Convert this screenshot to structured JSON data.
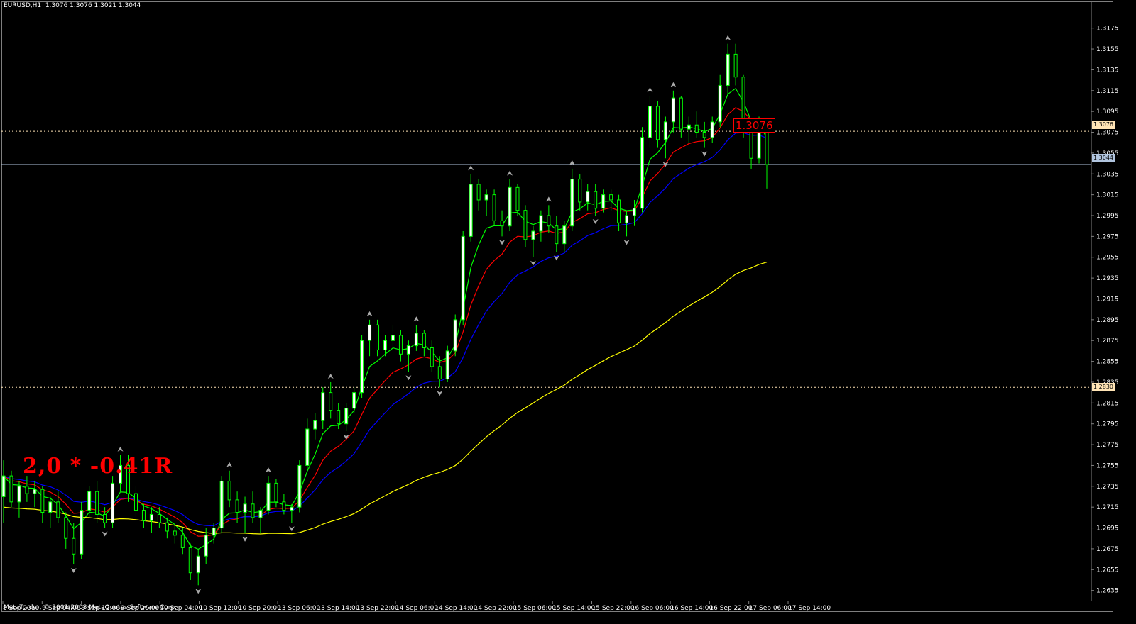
{
  "symbol_header": "EURUSD,H1  1.3076 1.3076 1.3021 1.3044",
  "copyright": "MetaTrader, © 2001-2008 MetaQuotes Software Corp.",
  "annotation_text": "2,0 * -0.41R",
  "level_label": "1.3076",
  "price_tags": {
    "upper_level": "1.3076",
    "current_price": "1.3044",
    "lower_level": "1.2830"
  },
  "colors": {
    "background": "#000000",
    "bull_candle": "#ffffff",
    "bear_candle": "#000000",
    "candle_wick": "#00ff00",
    "ma_fast": "#00ff00",
    "ma_mid": "#ff0000",
    "ma_slow": "#0000ff",
    "ma_long": "#ffff00",
    "level_lines": "#ffe4b5",
    "current_price_line": "#b0c4de",
    "annotation": "#ff0000"
  },
  "price_axis": {
    "ticks": [
      "1.3175",
      "1.3155",
      "1.3135",
      "1.3115",
      "1.3095",
      "1.3075",
      "1.3055",
      "1.3035",
      "1.3015",
      "1.2995",
      "1.2975",
      "1.2955",
      "1.2935",
      "1.2915",
      "1.2895",
      "1.2875",
      "1.2855",
      "1.2835",
      "1.2815",
      "1.2795",
      "1.2775",
      "1.2755",
      "1.2735",
      "1.2715",
      "1.2695",
      "1.2675",
      "1.2655",
      "1.2635"
    ]
  },
  "time_axis": {
    "ticks": [
      "8 Sep 2010",
      "9 Sep 04:00",
      "9 Sep 12:00",
      "9 Sep 20:00",
      "10 Sep 04:00",
      "10 Sep 12:00",
      "10 Sep 20:00",
      "13 Sep 06:00",
      "13 Sep 14:00",
      "13 Sep 22:00",
      "14 Sep 06:00",
      "14 Sep 14:00",
      "14 Sep 22:00",
      "15 Sep 06:00",
      "15 Sep 14:00",
      "15 Sep 22:00",
      "16 Sep 06:00",
      "16 Sep 14:00",
      "16 Sep 22:00",
      "17 Sep 06:00",
      "17 Sep 14:00"
    ]
  },
  "chart_data": {
    "type": "candlestick",
    "symbol": "EURUSD",
    "timeframe": "H1",
    "ylim": [
      1.263,
      1.3185
    ],
    "levels": [
      1.3076,
      1.3044,
      1.283
    ],
    "series": [
      {
        "values": [
          [
            1.2725,
            1.276,
            1.27,
            1.2745
          ],
          [
            1.2745,
            1.275,
            1.2715,
            1.272
          ],
          [
            1.272,
            1.274,
            1.2705,
            1.2735
          ],
          [
            1.2735,
            1.2745,
            1.272,
            1.2728
          ],
          [
            1.2728,
            1.274,
            1.2715,
            1.2732
          ],
          [
            1.2732,
            1.2735,
            1.27,
            1.271
          ],
          [
            1.271,
            1.2725,
            1.2695,
            1.272
          ],
          [
            1.272,
            1.273,
            1.27,
            1.2705
          ],
          [
            1.2705,
            1.271,
            1.2675,
            1.2685
          ],
          [
            1.2685,
            1.27,
            1.266,
            1.267
          ],
          [
            1.267,
            1.272,
            1.2665,
            1.2712
          ],
          [
            1.2712,
            1.2735,
            1.2705,
            1.273
          ],
          [
            1.273,
            1.274,
            1.27,
            1.2708
          ],
          [
            1.2708,
            1.2715,
            1.2695,
            1.27
          ],
          [
            1.27,
            1.2745,
            1.2695,
            1.2738
          ],
          [
            1.2738,
            1.2765,
            1.273,
            1.2755
          ],
          [
            1.2755,
            1.2765,
            1.272,
            1.2728
          ],
          [
            1.2728,
            1.2735,
            1.2705,
            1.2712
          ],
          [
            1.2712,
            1.2718,
            1.2695,
            1.2702
          ],
          [
            1.2702,
            1.2715,
            1.269,
            1.2708
          ],
          [
            1.2708,
            1.2715,
            1.2695,
            1.27
          ],
          [
            1.27,
            1.2705,
            1.2685,
            1.2692
          ],
          [
            1.2692,
            1.27,
            1.268,
            1.2688
          ],
          [
            1.2688,
            1.2695,
            1.267,
            1.2676
          ],
          [
            1.2676,
            1.268,
            1.2645,
            1.2652
          ],
          [
            1.2652,
            1.2675,
            1.264,
            1.2668
          ],
          [
            1.2668,
            1.2695,
            1.266,
            1.2688
          ],
          [
            1.2688,
            1.27,
            1.268,
            1.2695
          ],
          [
            1.2695,
            1.2745,
            1.269,
            1.274
          ],
          [
            1.274,
            1.275,
            1.2715,
            1.2722
          ],
          [
            1.2722,
            1.273,
            1.27,
            1.271
          ],
          [
            1.271,
            1.2725,
            1.269,
            1.2718
          ],
          [
            1.2718,
            1.273,
            1.27,
            1.2705
          ],
          [
            1.2705,
            1.2715,
            1.269,
            1.2712
          ],
          [
            1.2712,
            1.2745,
            1.2708,
            1.2738
          ],
          [
            1.2738,
            1.2742,
            1.2715,
            1.272
          ],
          [
            1.272,
            1.2728,
            1.2708,
            1.2712
          ],
          [
            1.2712,
            1.2718,
            1.27,
            1.2715
          ],
          [
            1.2715,
            1.276,
            1.271,
            1.2755
          ],
          [
            1.2755,
            1.28,
            1.275,
            1.279
          ],
          [
            1.279,
            1.2805,
            1.278,
            1.2798
          ],
          [
            1.2798,
            1.283,
            1.279,
            1.2825
          ],
          [
            1.2825,
            1.2835,
            1.28,
            1.2808
          ],
          [
            1.2808,
            1.2815,
            1.279,
            1.2795
          ],
          [
            1.2795,
            1.2815,
            1.2788,
            1.281
          ],
          [
            1.281,
            1.283,
            1.2805,
            1.2825
          ],
          [
            1.2825,
            1.288,
            1.282,
            1.2875
          ],
          [
            1.2875,
            1.2895,
            1.286,
            1.289
          ],
          [
            1.289,
            1.2895,
            1.286,
            1.2866
          ],
          [
            1.2866,
            1.288,
            1.286,
            1.2875
          ],
          [
            1.2875,
            1.289,
            1.2868,
            1.288
          ],
          [
            1.288,
            1.2885,
            1.2855,
            1.2862
          ],
          [
            1.2862,
            1.2875,
            1.2845,
            1.287
          ],
          [
            1.287,
            1.289,
            1.2865,
            1.2882
          ],
          [
            1.2882,
            1.2885,
            1.286,
            1.2868
          ],
          [
            1.2868,
            1.2875,
            1.2845,
            1.285
          ],
          [
            1.285,
            1.286,
            1.283,
            1.2838
          ],
          [
            1.2838,
            1.287,
            1.2835,
            1.2865
          ],
          [
            1.2865,
            1.29,
            1.286,
            1.2895
          ],
          [
            1.2895,
            1.298,
            1.289,
            1.2975
          ],
          [
            1.2975,
            1.3035,
            1.297,
            1.3025
          ],
          [
            1.3025,
            1.303,
            1.3,
            1.301
          ],
          [
            1.301,
            1.302,
            1.2995,
            1.3015
          ],
          [
            1.3015,
            1.302,
            1.2985,
            1.299
          ],
          [
            1.299,
            1.3,
            1.2975,
            1.2985
          ],
          [
            1.2985,
            1.303,
            1.298,
            1.3022
          ],
          [
            1.3022,
            1.3025,
            1.2995,
            1.3
          ],
          [
            1.3,
            1.3005,
            1.2965,
            1.2972
          ],
          [
            1.2972,
            1.2985,
            1.2955,
            1.298
          ],
          [
            1.298,
            1.3,
            1.297,
            1.2995
          ],
          [
            1.2995,
            1.3005,
            1.2978,
            1.2985
          ],
          [
            1.2985,
            1.2995,
            1.296,
            1.2968
          ],
          [
            1.2968,
            1.299,
            1.296,
            1.2985
          ],
          [
            1.2985,
            1.304,
            1.298,
            1.303
          ],
          [
            1.303,
            1.3035,
            1.3,
            1.3008
          ],
          [
            1.3008,
            1.3025,
            1.3,
            1.3018
          ],
          [
            1.3018,
            1.3025,
            1.2995,
            1.3002
          ],
          [
            1.3002,
            1.302,
            1.2998,
            1.3015
          ],
          [
            1.3015,
            1.302,
            1.3,
            1.301
          ],
          [
            1.301,
            1.3015,
            1.298,
            1.2988
          ],
          [
            1.2988,
            1.3,
            1.2975,
            1.2995
          ],
          [
            1.2995,
            1.301,
            1.2985,
            1.3002
          ],
          [
            1.3002,
            1.308,
            1.2998,
            1.307
          ],
          [
            1.307,
            1.311,
            1.306,
            1.31
          ],
          [
            1.31,
            1.3105,
            1.306,
            1.3068
          ],
          [
            1.3068,
            1.309,
            1.305,
            1.3085
          ],
          [
            1.3085,
            1.3115,
            1.3075,
            1.3108
          ],
          [
            1.3108,
            1.311,
            1.307,
            1.3078
          ],
          [
            1.3078,
            1.309,
            1.3065,
            1.3082
          ],
          [
            1.3082,
            1.3095,
            1.307,
            1.3075
          ],
          [
            1.3075,
            1.3085,
            1.306,
            1.307
          ],
          [
            1.307,
            1.309,
            1.3065,
            1.3085
          ],
          [
            1.3085,
            1.313,
            1.308,
            1.312
          ],
          [
            1.312,
            1.316,
            1.311,
            1.315
          ],
          [
            1.315,
            1.316,
            1.312,
            1.3128
          ],
          [
            1.3128,
            1.313,
            1.307,
            1.3078
          ],
          [
            1.3078,
            1.3085,
            1.304,
            1.305
          ],
          [
            1.305,
            1.309,
            1.3045,
            1.3076
          ],
          [
            1.3076,
            1.3076,
            1.3021,
            1.3044
          ]
        ]
      },
      {
        "name": "",
        "values": []
      }
    ]
  }
}
